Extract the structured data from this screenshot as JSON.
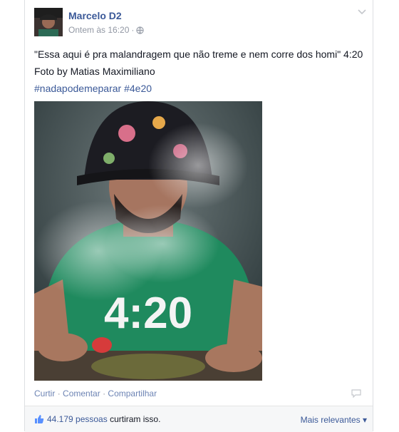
{
  "post": {
    "author": "Marcelo D2",
    "timestamp": "Ontem às 16:20",
    "privacy_icon": "globe-icon",
    "text_line1": "\"Essa aqui é pra malandragem que não treme e nem corre dos homi\" 4:20",
    "text_line2": "Foto by Matias Maximiliano",
    "hashtag1": "#nadapodemeparar",
    "hashtag2": "#4e20",
    "shirt_text": "4:20"
  },
  "actions": {
    "like": "Curtir",
    "comment": "Comentar",
    "share": "Compartilhar",
    "separator": "·"
  },
  "likes": {
    "count_link": "44.179 pessoas",
    "suffix": "curtiram isso.",
    "sort_label": "Mais relevantes ▾"
  },
  "colors": {
    "link": "#3b5998",
    "muted": "#9197a3",
    "shirt": "#1f8a5e"
  }
}
